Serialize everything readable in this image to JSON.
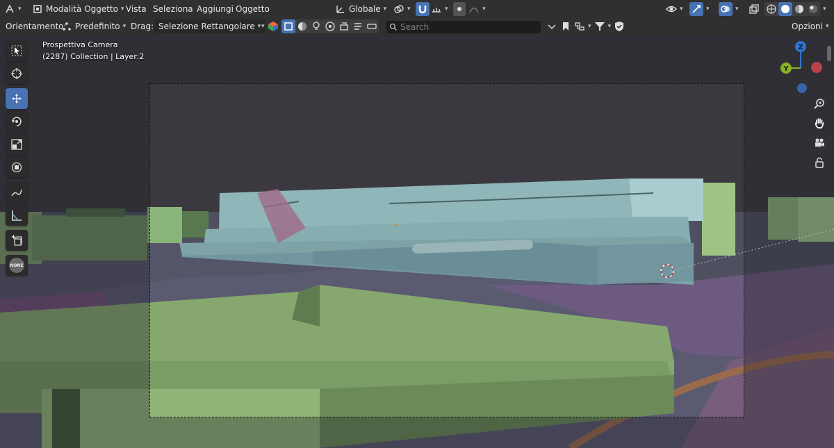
{
  "header": {
    "mode_label": "Modalità Oggetto",
    "menus": [
      "Vista",
      "Seleziona",
      "Aggiungi",
      "Oggetto"
    ],
    "transform_orientation": "Globale"
  },
  "tool_settings": {
    "orientation_label": "Orientamento:",
    "orientation_value": "Predefinito",
    "drag_label": "Drag:",
    "drag_value": "Selezione Rettangolare",
    "search_placeholder": "Search",
    "options_label": "Opzioni"
  },
  "viewport": {
    "view_name": "Prospettiva Camera",
    "collection_info": "(2287) Collection | Layer:2"
  },
  "toolbar": {
    "annotate_badge": "NONE"
  },
  "gizmo": {
    "axis_z": "Z",
    "axis_y": "Y",
    "color_x": "#d0474f",
    "color_y": "#86b324",
    "color_z": "#2f74d0"
  },
  "theme": {
    "accent": "#4772b3"
  }
}
